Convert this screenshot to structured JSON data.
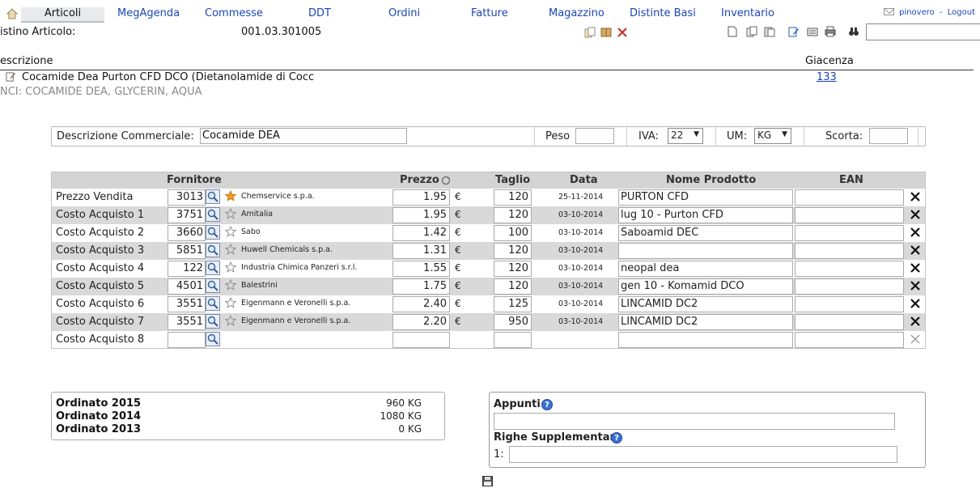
{
  "nav": {
    "items": [
      "Articoli",
      "MegAgenda",
      "Commesse",
      "DDT",
      "Ordini",
      "Fatture",
      "Magazzino",
      "Distinte Basi",
      "Inventario"
    ],
    "user": "pinovero",
    "separator": "-",
    "logout": "Logout"
  },
  "listino": {
    "label": "istino Articolo:",
    "code": "001.03.301005"
  },
  "headers": {
    "descrizione": "escrizione",
    "giacenza": "Giacenza"
  },
  "article": {
    "name": "Cocamide Dea Purton CFD DCO (Dietanolamide di Cocc",
    "inci": "NCI: COCAMIDE DEA, GLYCERIN, AQUA",
    "giacenza": "133"
  },
  "commerciale": {
    "desc_label": "Descrizione Commerciale:",
    "desc_value": "Cocamide DEA",
    "peso_label": "Peso",
    "peso_value": "",
    "iva_label": "IVA:",
    "iva_value": "22",
    "um_label": "UM:",
    "um_value": "KG",
    "scorta_label": "Scorta:",
    "scorta_value": ""
  },
  "table": {
    "headers": {
      "fornitore": "Fornitore",
      "prezzo": "Prezzo",
      "taglio": "Taglio",
      "data": "Data",
      "nome": "Nome Prodotto",
      "ean": "EAN"
    },
    "currency": "€",
    "rows": [
      {
        "label": "Prezzo Vendita",
        "code": "3013",
        "starred": true,
        "supplier": "Chemservice s.p.a.",
        "price": "1.95",
        "taglio": "120",
        "data": "25-11-2014",
        "nome": "PURTON CFD",
        "ean": ""
      },
      {
        "label": "Costo Acquisto 1",
        "code": "3751",
        "starred": false,
        "supplier": "Amitalia",
        "price": "1.95",
        "taglio": "120",
        "data": "03-10-2014",
        "nome": "lug 10 - Purton CFD",
        "ean": ""
      },
      {
        "label": "Costo Acquisto 2",
        "code": "3660",
        "starred": false,
        "supplier": "Sabo",
        "price": "1.42",
        "taglio": "100",
        "data": "03-10-2014",
        "nome": "Saboamid DEC",
        "ean": ""
      },
      {
        "label": "Costo Acquisto 3",
        "code": "5851",
        "starred": false,
        "supplier": "Huwell Chemicals s.p.a.",
        "price": "1.31",
        "taglio": "120",
        "data": "03-10-2014",
        "nome": "",
        "ean": ""
      },
      {
        "label": "Costo Acquisto 4",
        "code": "122",
        "starred": false,
        "supplier": "Industria Chimica Panzeri s.r.l.",
        "price": "1.55",
        "taglio": "120",
        "data": "03-10-2014",
        "nome": "neopal dea",
        "ean": ""
      },
      {
        "label": "Costo Acquisto 5",
        "code": "4501",
        "starred": false,
        "supplier": "Balestrini",
        "price": "1.75",
        "taglio": "120",
        "data": "03-10-2014",
        "nome": "gen 10 - Komamid DCO",
        "ean": ""
      },
      {
        "label": "Costo Acquisto 6",
        "code": "3551",
        "starred": false,
        "supplier": "Eigenmann e Veronelli s.p.a.",
        "price": "2.40",
        "taglio": "125",
        "data": "03-10-2014",
        "nome": "LINCAMID DC2",
        "ean": ""
      },
      {
        "label": "Costo Acquisto 7",
        "code": "3551",
        "starred": false,
        "supplier": "Eigenmann e Veronelli s.p.a.",
        "price": "2.20",
        "taglio": "950",
        "data": "03-10-2014",
        "nome": "LINCAMID DC2",
        "ean": ""
      },
      {
        "label": "Costo Acquisto 8",
        "code": "",
        "starred": null,
        "supplier": "",
        "price": "",
        "taglio": "",
        "data": "",
        "nome": "",
        "ean": "",
        "empty": true
      }
    ]
  },
  "ordinato": [
    {
      "label": "Ordinato 2015",
      "value": "960 KG"
    },
    {
      "label": "Ordinato 2014",
      "value": "1080 KG"
    },
    {
      "label": "Ordinato 2013",
      "value": "0 KG"
    }
  ],
  "appunti": {
    "title": "Appunti",
    "righe_title": "Righe Supplementari",
    "righe_prefix": "1:"
  },
  "colors": {
    "link": "#1a46b8",
    "row_alt": "#d9d9d9",
    "header_bg": "#d4d4d4",
    "star_active": "#f0a020"
  }
}
